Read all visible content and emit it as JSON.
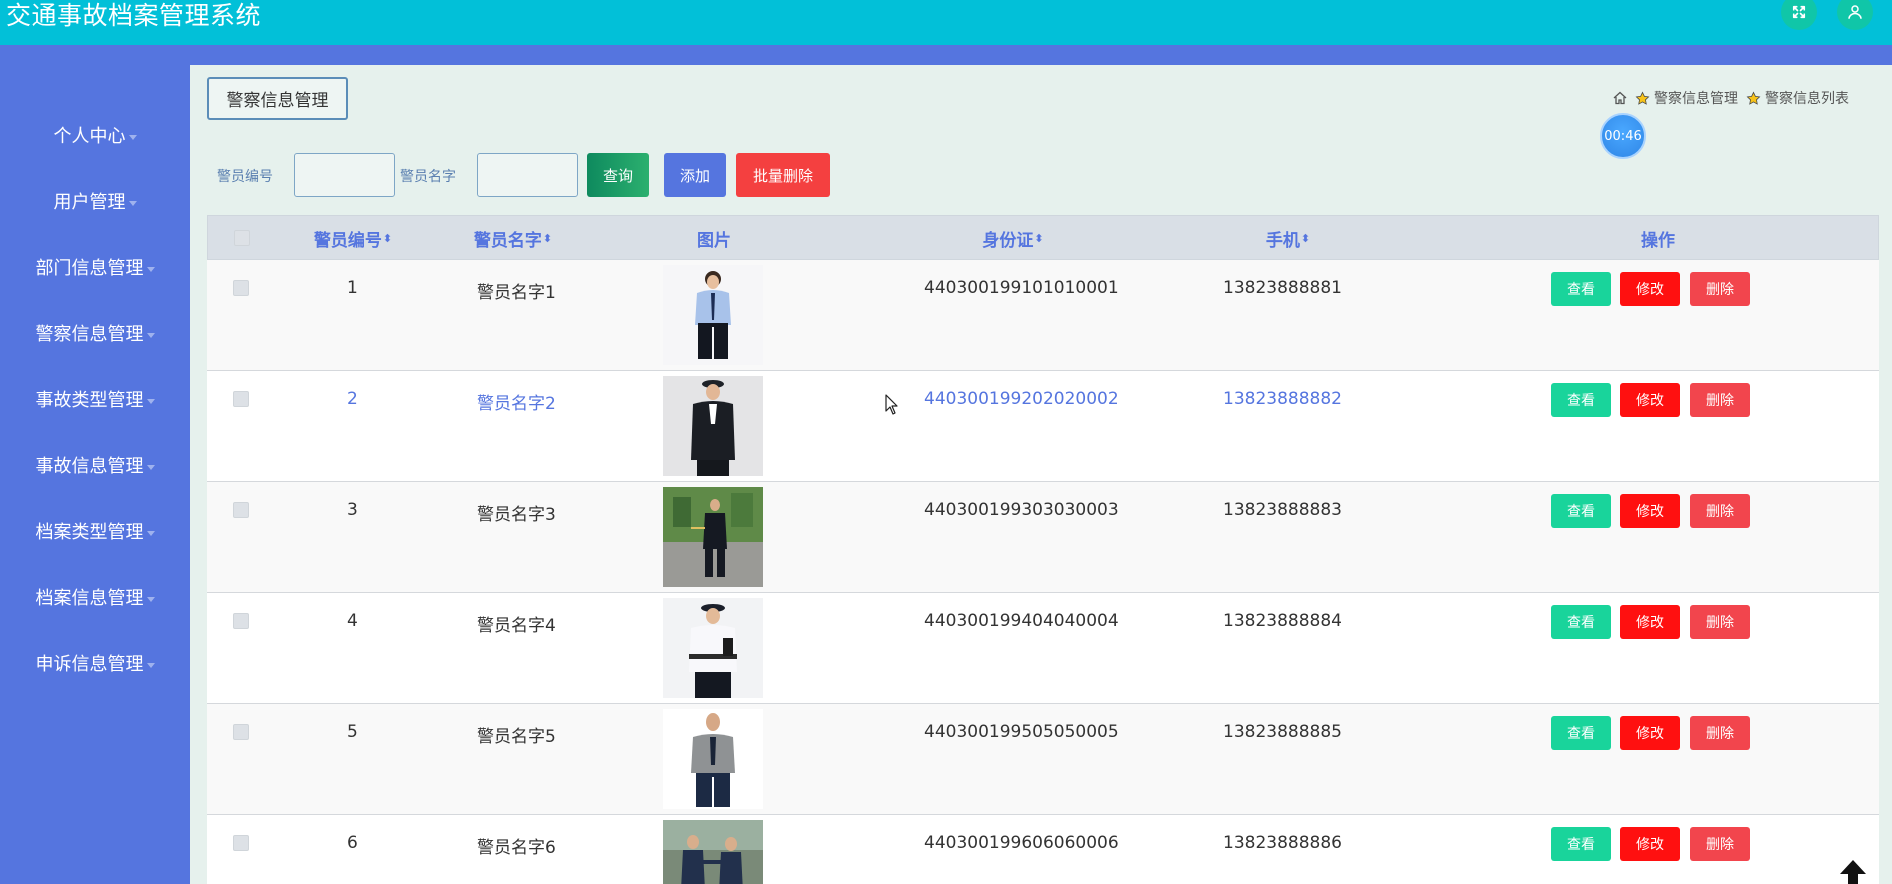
{
  "app": {
    "title": "交通事故档案管理系统"
  },
  "topbar": {
    "fullscreen_icon": "expand-icon",
    "user_icon": "user-icon"
  },
  "sidebar": {
    "items": [
      {
        "label": "个人中心"
      },
      {
        "label": "用户管理"
      },
      {
        "label": "部门信息管理"
      },
      {
        "label": "警察信息管理"
      },
      {
        "label": "事故类型管理"
      },
      {
        "label": "事故信息管理"
      },
      {
        "label": "档案类型管理"
      },
      {
        "label": "档案信息管理"
      },
      {
        "label": "申诉信息管理"
      }
    ]
  },
  "page": {
    "tag": "警察信息管理",
    "breadcrumb": [
      "警察信息管理",
      "警察信息列表"
    ],
    "timer": "00:46"
  },
  "search": {
    "officer_no_label": "警员编号",
    "officer_no_value": "",
    "officer_name_label": "警员名字",
    "officer_name_value": "",
    "query_label": "查询",
    "add_label": "添加",
    "batch_delete_label": "批量删除"
  },
  "table": {
    "headers": {
      "officer_no": "警员编号",
      "officer_name": "警员名字",
      "photo": "图片",
      "id_card": "身份证",
      "phone": "手机",
      "actions": "操作"
    },
    "action_labels": {
      "view": "查看",
      "edit": "修改",
      "delete": "删除"
    },
    "rows": [
      {
        "no": "1",
        "name": "警员名字1",
        "id_card": "440300199101010001",
        "phone": "13823888881"
      },
      {
        "no": "2",
        "name": "警员名字2",
        "id_card": "440300199202020002",
        "phone": "13823888882"
      },
      {
        "no": "3",
        "name": "警员名字3",
        "id_card": "440300199303030003",
        "phone": "13823888883"
      },
      {
        "no": "4",
        "name": "警员名字4",
        "id_card": "440300199404040004",
        "phone": "13823888884"
      },
      {
        "no": "5",
        "name": "警员名字5",
        "id_card": "440300199505050005",
        "phone": "13823888885"
      },
      {
        "no": "6",
        "name": "警员名字6",
        "id_card": "440300199606060006",
        "phone": "13823888886"
      }
    ]
  },
  "colors": {
    "topbar": "#02c0d8",
    "sidebar": "#5575df",
    "content_bg": "#e6f1ed",
    "view_button": "#19d49b",
    "edit_button": "#ff1010",
    "delete_button": "#f2454d"
  }
}
